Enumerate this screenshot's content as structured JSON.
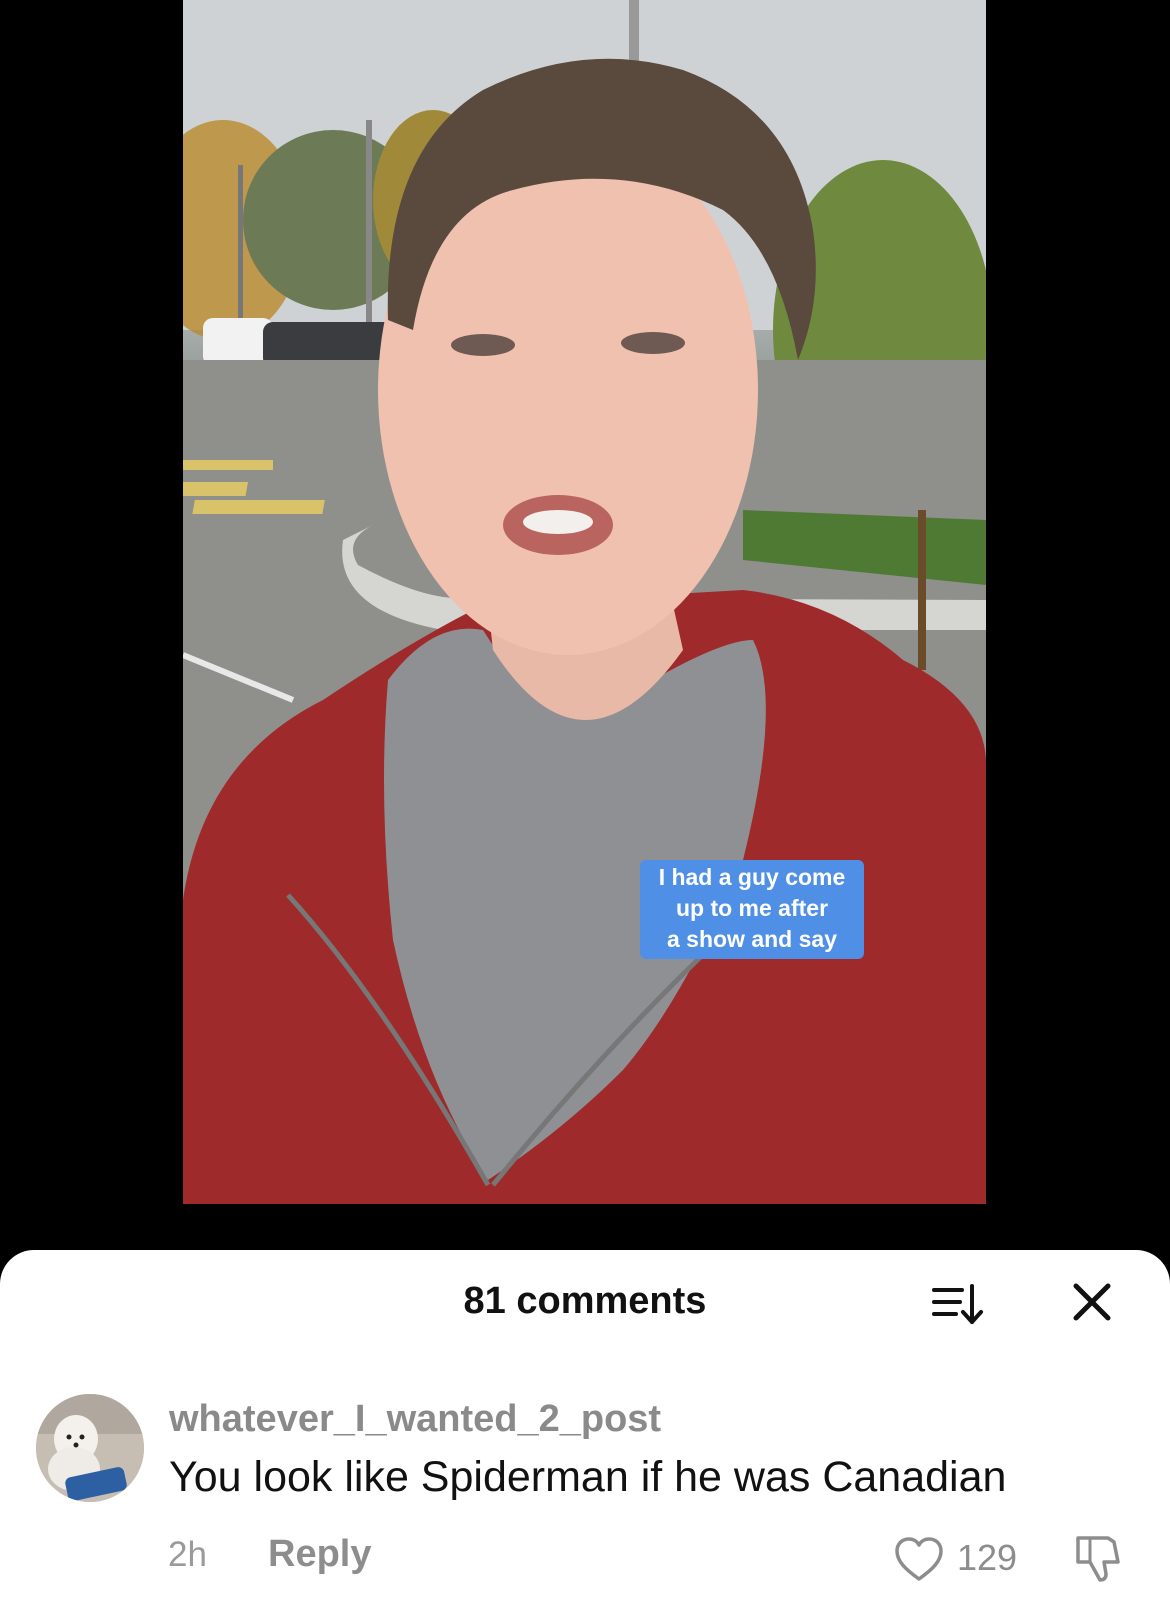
{
  "video": {
    "caption_lines": [
      "I had a guy come",
      "up to me after",
      "a show and say"
    ]
  },
  "comments_sheet": {
    "count_label": "81 comments",
    "sort_icon": "sort-icon",
    "close_icon": "close-icon"
  },
  "comment": {
    "username": "whatever_I_wanted_2_post",
    "text": "You look like Spiderman if he was Canadian",
    "time": "2h",
    "reply_label": "Reply",
    "like_count": "129",
    "like_icon": "heart-outline-icon",
    "dislike_icon": "thumbs-down-icon"
  },
  "colors": {
    "caption_bg": "#4f8fe6",
    "sheet_bg": "#ffffff",
    "hoodie": "#9e2a2b"
  }
}
